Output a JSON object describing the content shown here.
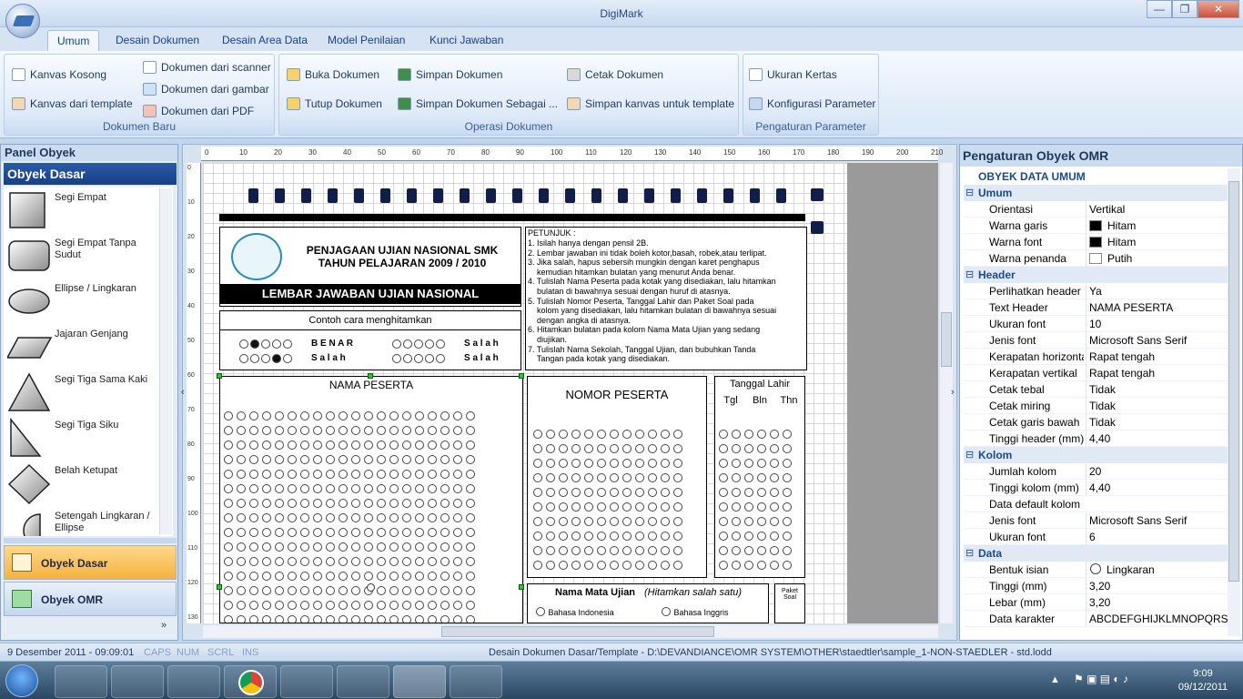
{
  "window": {
    "title": "DigiMark",
    "min": "—",
    "max": "❐",
    "close": "✕"
  },
  "tabs": [
    "Umum",
    "Desain Dokumen",
    "Desain Area Data",
    "Model Penilaian",
    "Kunci Jawaban"
  ],
  "ribbon": {
    "groups": [
      {
        "label": "Dokumen Baru",
        "buttons": [
          "Kanvas Kosong",
          "Kanvas dari template",
          "Dokumen dari scanner",
          "Dokumen dari gambar",
          "Dokumen dari PDF"
        ]
      },
      {
        "label": "Operasi Dokumen",
        "buttons": [
          "Buka Dokumen",
          "Tutup Dokumen",
          "Simpan Dokumen",
          "Simpan Dokumen Sebagai ...",
          "Cetak Dokumen",
          "Simpan kanvas untuk template"
        ]
      },
      {
        "label": "Pengaturan Parameter",
        "buttons": [
          "Ukuran Kertas",
          "Konfigurasi Parameter"
        ]
      }
    ]
  },
  "left_panel": {
    "title": "Panel Obyek",
    "header": "Obyek Dasar",
    "shapes": [
      "Segi Empat",
      "Segi Empat Tanpa Sudut",
      "Ellipse / Lingkaran",
      "Jajaran Genjang",
      "Segi Tiga Sama Kaki",
      "Segi Tiga Siku",
      "Belah Ketupat",
      "Setengah Lingkaran / Ellipse"
    ],
    "nav": [
      "Obyek Dasar",
      "Obyek OMR"
    ]
  },
  "ruler": {
    "top": [
      "0",
      "10",
      "20",
      "30",
      "40",
      "50",
      "60",
      "70",
      "80",
      "90",
      "100",
      "110",
      "120",
      "130",
      "140",
      "150",
      "160",
      "170",
      "180",
      "190",
      "200",
      "210"
    ],
    "left": [
      "0",
      "10",
      "20",
      "30",
      "40",
      "50",
      "60",
      "70",
      "80",
      "90",
      "100",
      "110",
      "120",
      "130"
    ]
  },
  "document": {
    "school_title1": "PENJAGAAN UJIAN NASIONAL SMK",
    "school_title2": "TAHUN PELAJARAN 2009 / 2010",
    "sheet_title": "LEMBAR JAWABAN UJIAN NASIONAL",
    "example_title": "Contoh cara menghitamkan",
    "benar": "B E N A R",
    "salah1": "S a l a h",
    "salah2": "S a l a h",
    "salah3": "S a l a h",
    "petunjuk_title": "PETUNJUK :",
    "petunjuk": [
      "1. Isilah hanya dengan pensil 2B.",
      "2. Lembar jawaban ini tidak boleh kotor,basah, robek,atau terlipat.",
      "3. Jika salah, hapus sebersih mungkin dengan karet penghapus",
      "    kemudian hitamkan bulatan yang menurut Anda benar.",
      "4. Tulislah Nama Peserta pada kotak yang disediakan, lalu hitamkan",
      "    bulatan di bawahnya sesuai dengan huruf di atasnya.",
      "5. Tulislah Nomor Peserta, Tanggal Lahir dan Paket Soal pada",
      "    kolom yang disediakan, lalu hitamkan bulatan di bawahnya sesuai",
      "    dengan angka di atasnya.",
      "6. Hitamkan bulatan pada kolom Nama Mata Ujian yang sedang",
      "    diujikan.",
      "7. Tulislah Nama Sekolah, Tanggal Ujian, dan bubuhkan Tanda",
      "    Tangan pada kotak yang disediakan."
    ],
    "nama_peserta": "NAMA PESERTA",
    "nomor_peserta": "NOMOR PESERTA",
    "tanggal_lahir": "Tanggal Lahir",
    "tgl": "Tgl",
    "bln": "Bln",
    "thn": "Thn",
    "mata_ujian": "Nama Mata Ujian",
    "mata_ujian_note": "(Hitamkan salah satu)",
    "bahasa1": "Bahasa Indonesia",
    "bahasa2": "Bahasa Inggris",
    "paket": "Paket Soal"
  },
  "right_panel": {
    "title": "Pengaturan Obyek OMR",
    "subtitle": "OBYEK DATA UMUM",
    "categories": [
      {
        "name": "Umum",
        "rows": [
          [
            "Orientasi",
            "Vertikal"
          ],
          [
            "Warna garis",
            "Hitam"
          ],
          [
            "Warna font",
            "Hitam"
          ],
          [
            "Warna penanda",
            "Putih"
          ]
        ]
      },
      {
        "name": "Header",
        "rows": [
          [
            "Perlihatkan header",
            "Ya"
          ],
          [
            "Text Header",
            "NAMA PESERTA"
          ],
          [
            "Ukuran font",
            "10"
          ],
          [
            "Jenis font",
            "Microsoft Sans Serif"
          ],
          [
            "Kerapatan horizontal",
            "Rapat tengah"
          ],
          [
            "Kerapatan vertikal",
            "Rapat tengah"
          ],
          [
            "Cetak tebal",
            "Tidak"
          ],
          [
            "Cetak miring",
            "Tidak"
          ],
          [
            "Cetak garis bawah",
            "Tidak"
          ],
          [
            "Tinggi header (mm)",
            "4,40"
          ]
        ]
      },
      {
        "name": "Kolom",
        "rows": [
          [
            "Jumlah kolom",
            "20"
          ],
          [
            "Tinggi kolom (mm)",
            "4,40"
          ],
          [
            "Data default kolom",
            ""
          ],
          [
            "Jenis font",
            "Microsoft Sans Serif"
          ],
          [
            "Ukuran font",
            "6"
          ]
        ]
      },
      {
        "name": "Data",
        "rows": [
          [
            "Bentuk isian",
            "Lingkaran"
          ],
          [
            "Tinggi (mm)",
            "3,20"
          ],
          [
            "Lebar (mm)",
            "3,20"
          ],
          [
            "Data karakter",
            "ABCDEFGHIJKLMNOPQRSTUVWXYZ"
          ]
        ]
      }
    ],
    "colors": {
      "Hitam": "#000000",
      "Putih": "#ffffff"
    }
  },
  "status": {
    "datetime": "9 Desember 2011 - 09:09:01",
    "keys": [
      "CAPS",
      "NUM",
      "SCRL",
      "INS"
    ],
    "path": "Desain Dokumen Dasar/Template - D:\\DEVANDIANCE\\OMR SYSTEM\\OTHER\\staedtler\\sample_1-NON-STAEDLER - std.lodd"
  },
  "taskbar": {
    "time": "9:09",
    "date": "09/12/2011"
  }
}
